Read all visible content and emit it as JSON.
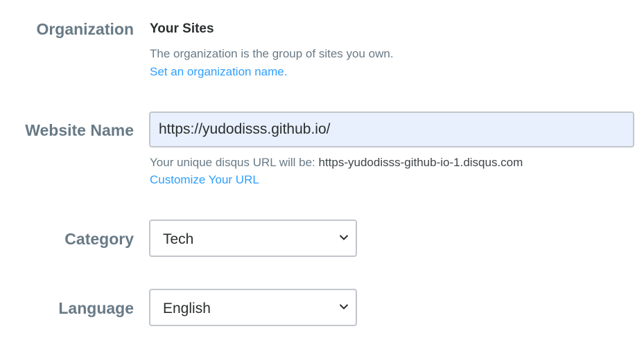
{
  "organization": {
    "label": "Organization",
    "value": "Your Sites",
    "help": "The organization is the group of sites you own.",
    "link": "Set an organization name."
  },
  "website": {
    "label": "Website Name",
    "value": "https://yudodisss.github.io/",
    "help_prefix": "Your unique disqus URL will be: ",
    "help_url": "https-yudodisss-github-io-1.disqus.com",
    "link": "Customize Your URL"
  },
  "category": {
    "label": "Category",
    "selected": "Tech",
    "icon": "chevron-down-icon"
  },
  "language": {
    "label": "Language",
    "selected": "English",
    "icon": "chevron-down-icon"
  },
  "colors": {
    "label": "#687a86",
    "link": "#2e9fff",
    "input_autofill_bg": "#e8f0fe",
    "border": "#c2c6cc"
  }
}
